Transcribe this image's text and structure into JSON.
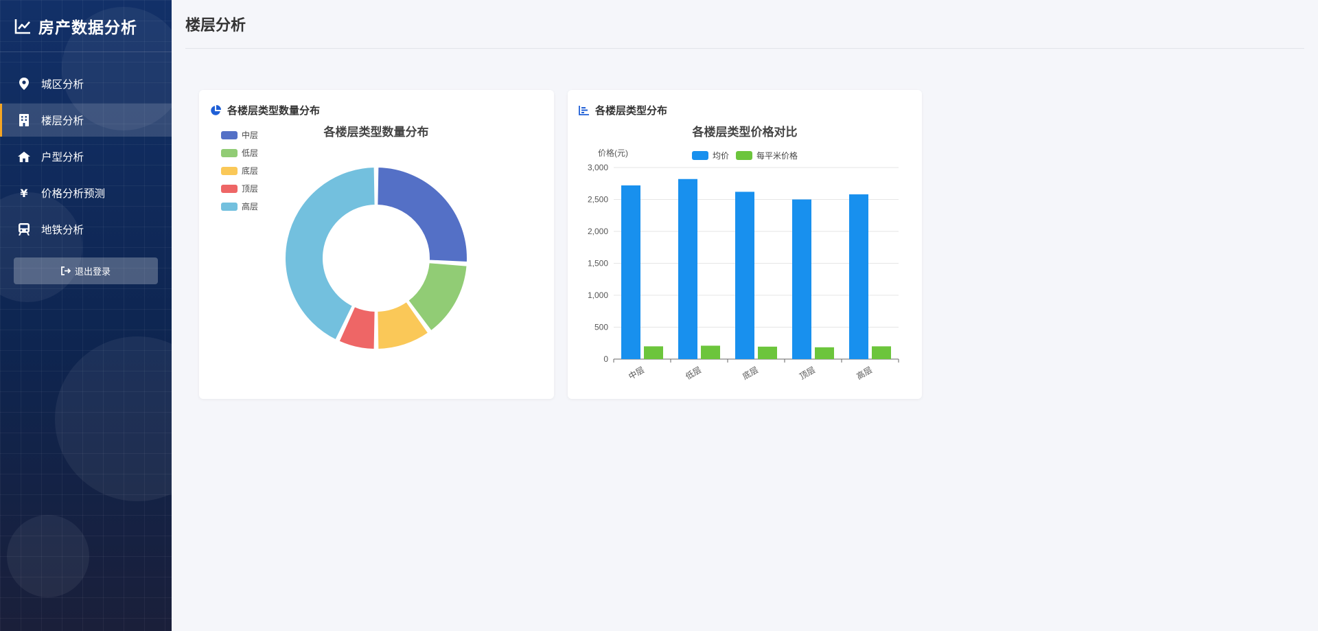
{
  "app": {
    "title": "房产数据分析"
  },
  "sidebar": {
    "items": [
      {
        "label": "城区分析",
        "icon": "map-pin-icon",
        "active": false
      },
      {
        "label": "楼层分析",
        "icon": "building-icon",
        "active": true
      },
      {
        "label": "户型分析",
        "icon": "home-icon",
        "active": false
      },
      {
        "label": "价格分析预测",
        "icon": "yen-icon",
        "active": false
      },
      {
        "label": "地铁分析",
        "icon": "subway-icon",
        "active": false
      }
    ],
    "logout_label": "退出登录"
  },
  "page": {
    "title": "楼层分析"
  },
  "cards": [
    {
      "title": "各楼层类型数量分布",
      "icon": "pie-chart-icon"
    },
    {
      "title": "各楼层类型分布",
      "icon": "bar-chart-icon"
    }
  ],
  "colors": {
    "accent": "#f5a623",
    "pie": [
      "#5470c6",
      "#91cc75",
      "#fac858",
      "#ee6666",
      "#73c0de"
    ],
    "bar_avg": "#1890ee",
    "bar_sqm": "#6cc53c"
  },
  "chart_data": [
    {
      "type": "pie",
      "title": "各楼层类型数量分布",
      "legend_position": "top-left",
      "donut": true,
      "categories": [
        "中层",
        "低层",
        "底层",
        "顶层",
        "高层"
      ],
      "values": [
        26,
        14,
        10,
        7,
        43
      ]
    },
    {
      "type": "bar",
      "title": "各楼层类型价格对比",
      "ylabel": "价格(元)",
      "legend_position": "top",
      "categories": [
        "中层",
        "低层",
        "底层",
        "顶层",
        "高层"
      ],
      "ylim": [
        0,
        3000
      ],
      "yticks": [
        "0",
        "500",
        "1,000",
        "1,500",
        "2,000",
        "2,500",
        "3,000"
      ],
      "grid": true,
      "series": [
        {
          "name": "均价",
          "values": [
            2720,
            2820,
            2620,
            2500,
            2580
          ]
        },
        {
          "name": "每平米价格",
          "values": [
            200,
            210,
            195,
            185,
            200
          ]
        }
      ]
    }
  ]
}
